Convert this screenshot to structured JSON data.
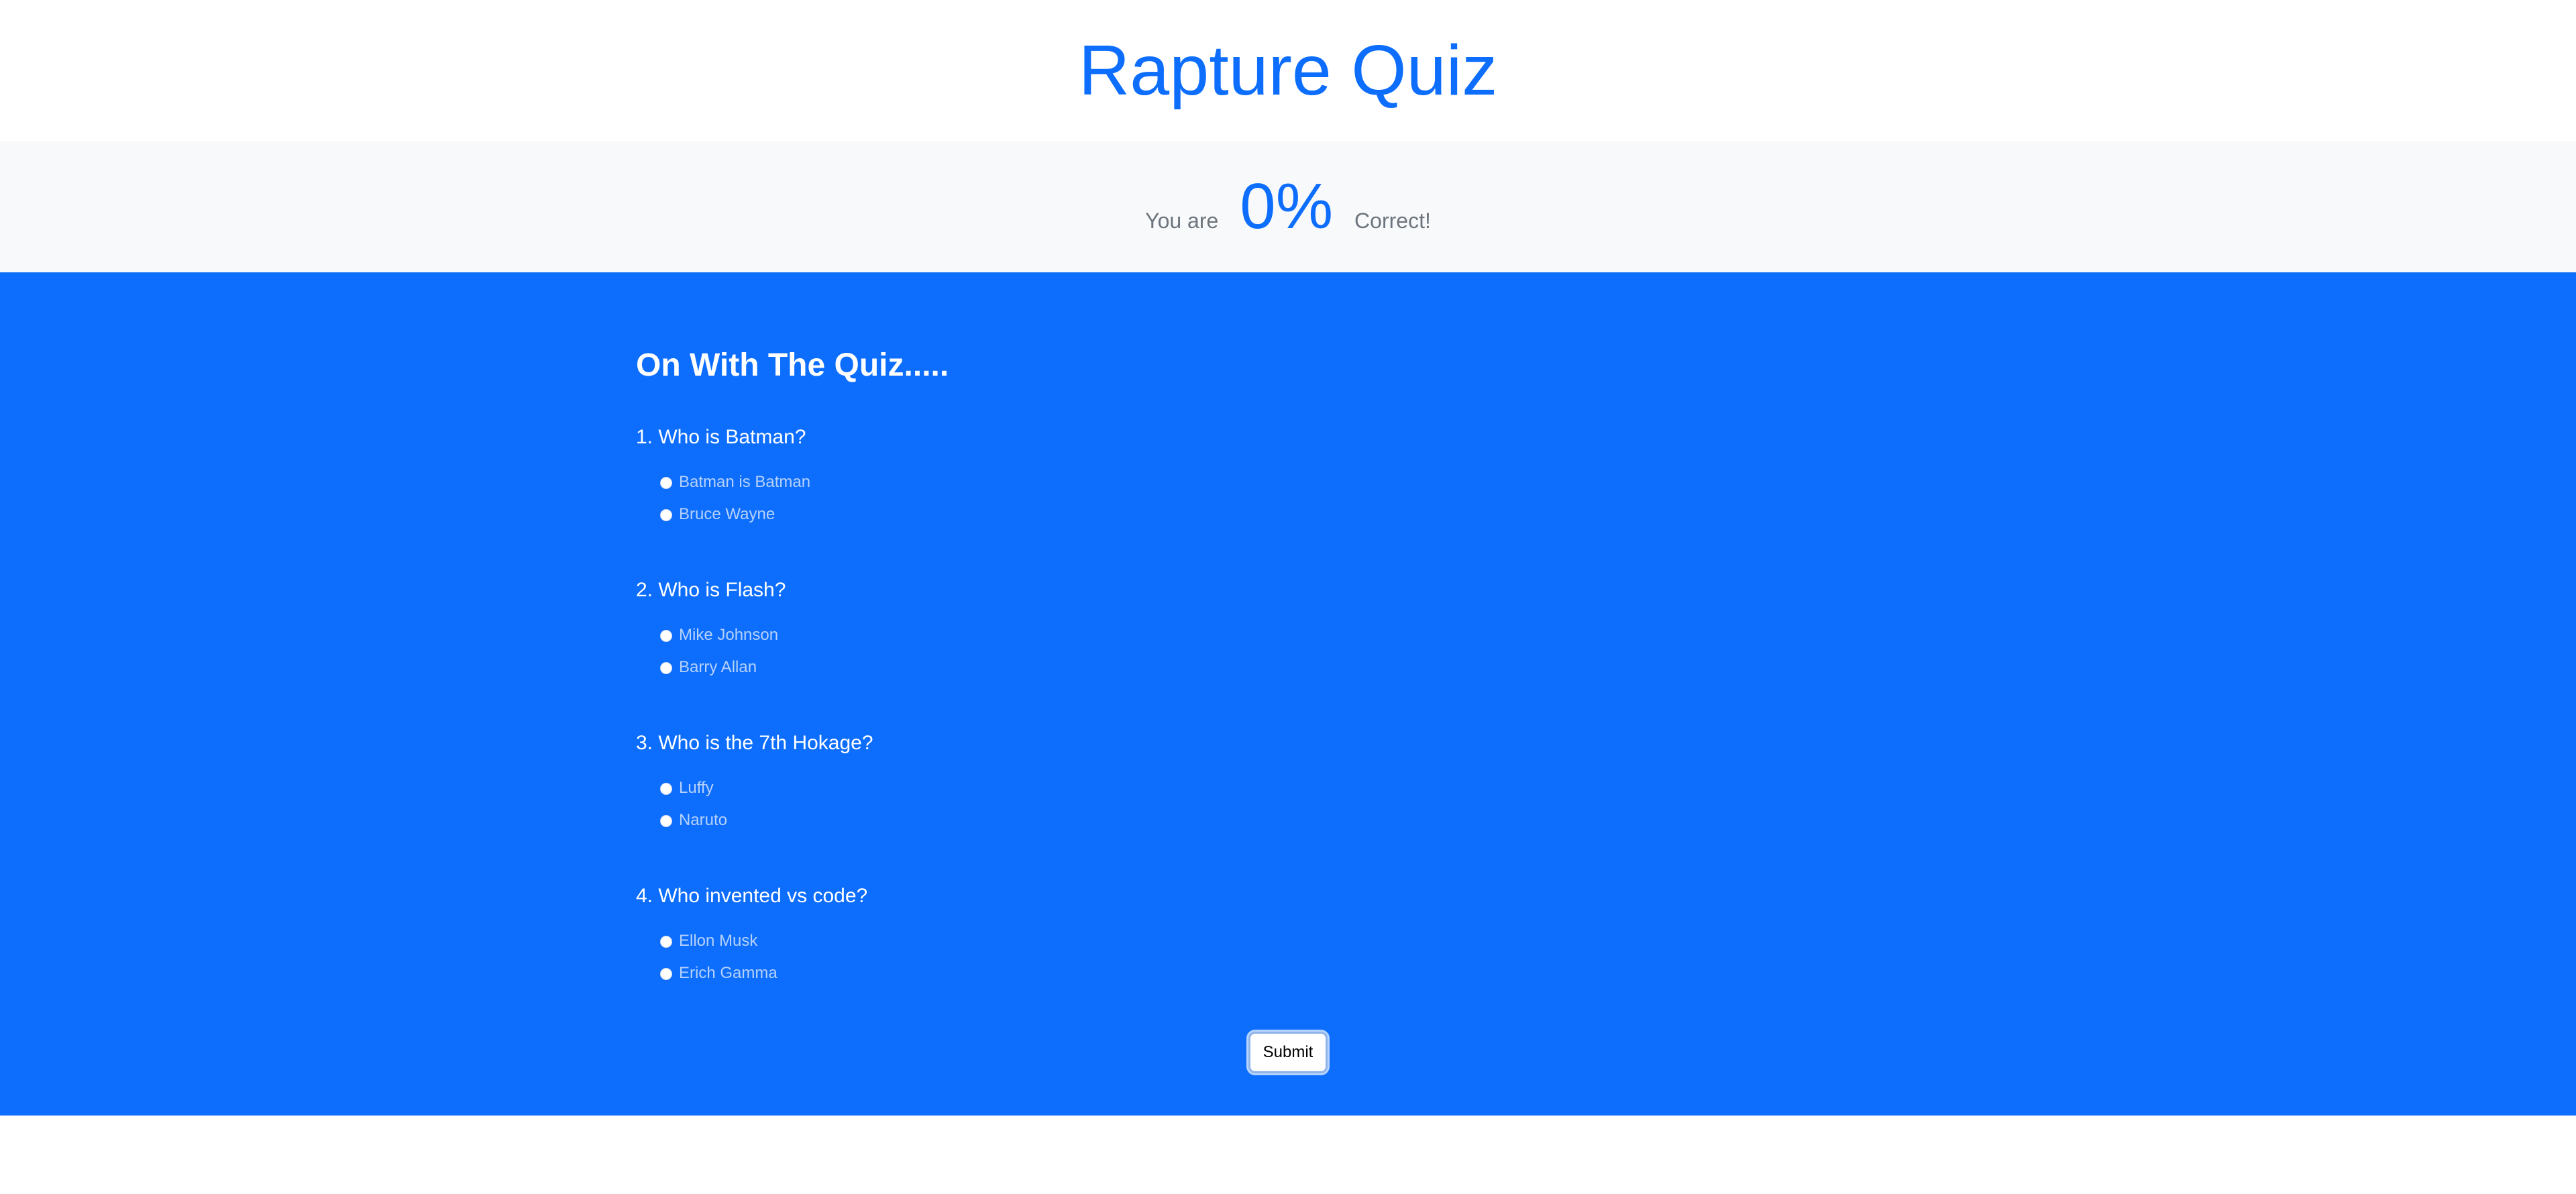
{
  "header": {
    "title": "Rapture Quiz"
  },
  "score": {
    "prefix": "You are",
    "value": "0%",
    "suffix": "Correct!"
  },
  "quiz": {
    "heading": "On With The Quiz.....",
    "questions": [
      {
        "text": "1. Who is Batman?",
        "options": [
          "Batman is Batman",
          "Bruce Wayne"
        ]
      },
      {
        "text": "2. Who is Flash?",
        "options": [
          "Mike Johnson",
          "Barry Allan"
        ]
      },
      {
        "text": "3. Who is the 7th Hokage?",
        "options": [
          "Luffy",
          "Naruto"
        ]
      },
      {
        "text": "4. Who invented vs code?",
        "options": [
          "Ellon Musk",
          "Erich Gamma"
        ]
      }
    ],
    "submit_label": "Submit"
  },
  "colors": {
    "primary": "#0d6efd",
    "score_band_bg": "#f8f9fa",
    "text_muted": "#6c757d",
    "option_text": "#b6d1fb"
  }
}
